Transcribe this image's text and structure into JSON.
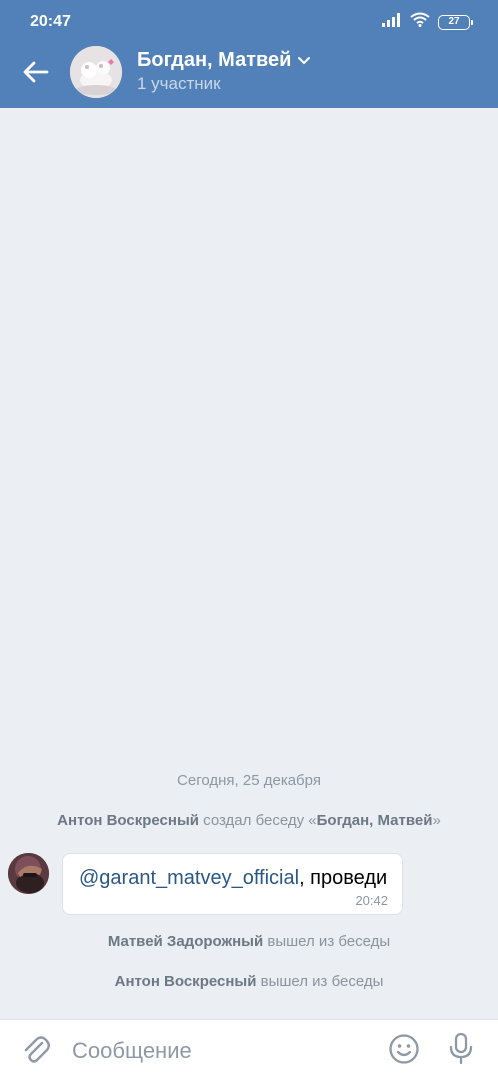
{
  "status_bar": {
    "time": "20:47",
    "battery": "27"
  },
  "header": {
    "title": "Богдан, Матвей",
    "subtitle": "1 участник"
  },
  "colors": {
    "header_bg": "#5181b8",
    "chat_bg": "#ebeef2",
    "link": "#2a5885"
  },
  "icons": {
    "back": "arrow-left-icon",
    "title_expand": "chevron-down-icon",
    "attach": "paperclip-icon",
    "emoji": "smile-icon",
    "voice": "microphone-icon"
  },
  "chat": {
    "date_separator": "Сегодня, 25 декабря",
    "events": [
      {
        "actor": "Антон Воскресный",
        "text": " создал беседу «",
        "target": "Богдан, Матвей",
        "suffix": "»"
      },
      {
        "actor": "Матвей Задорожный",
        "text": " вышел из беседы"
      },
      {
        "actor": "Антон Воскресный",
        "text": " вышел из беседы"
      }
    ],
    "message": {
      "mention": "@garant_matvey_official",
      "text": ", проведи",
      "time": "20:42"
    }
  },
  "composer": {
    "placeholder": "Сообщение"
  }
}
